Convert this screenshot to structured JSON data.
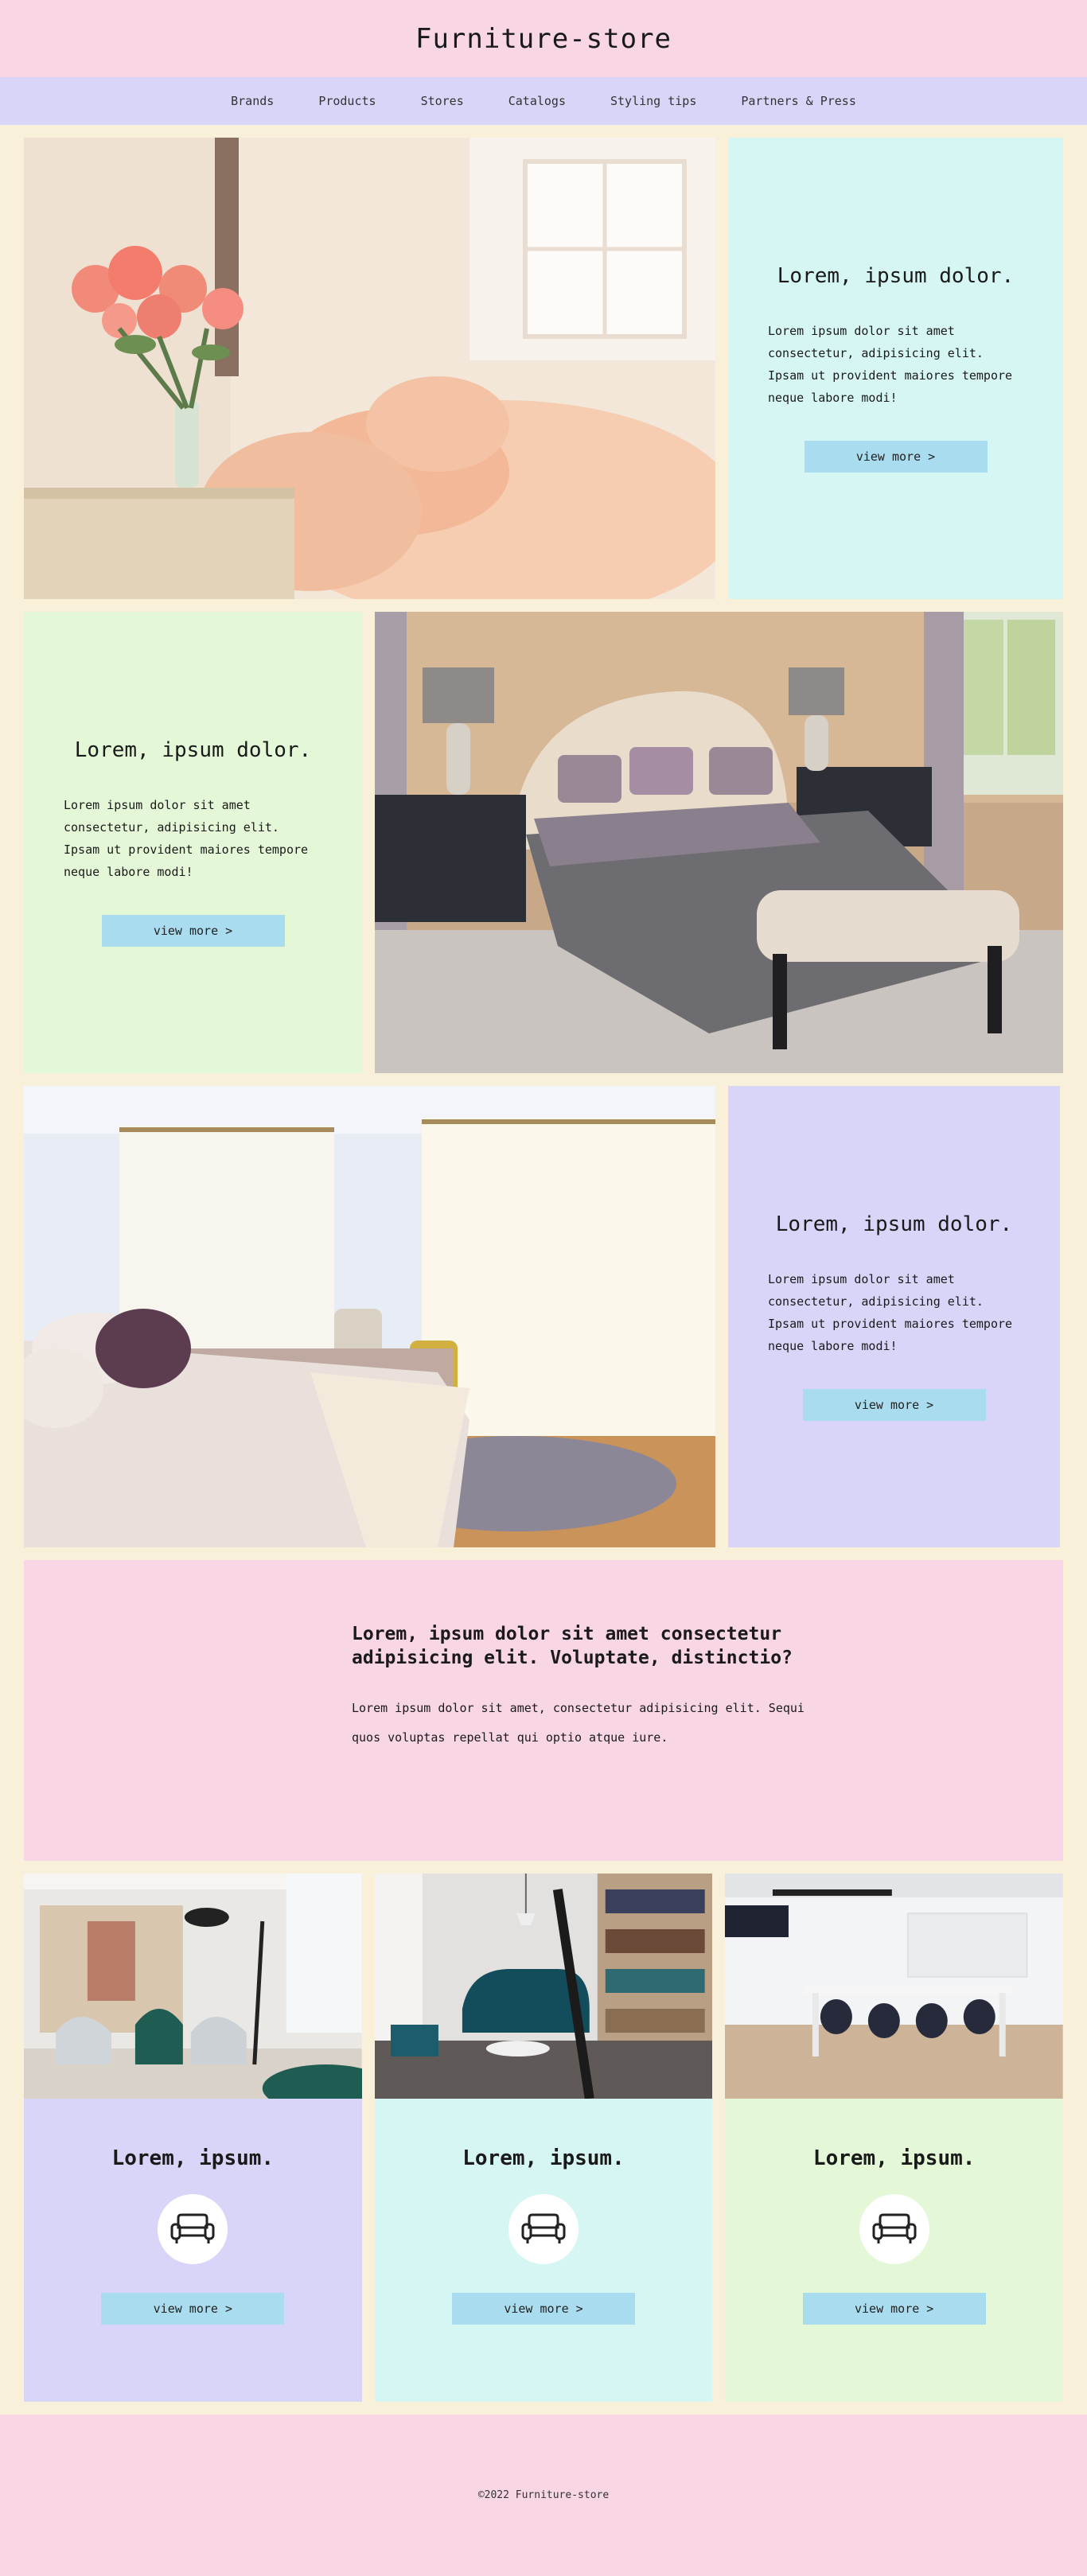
{
  "site": {
    "title": "Furniture-store"
  },
  "nav": {
    "items": [
      "Brands",
      "Products",
      "Stores",
      "Catalogs",
      "Styling tips",
      "Partners & Press"
    ]
  },
  "sections": [
    {
      "heading": "Lorem, ipsum dolor.",
      "text": "Lorem ipsum dolor sit amet consectetur, adipisicing elit. Ipsam ut provident maiores tempore neque labore modi!",
      "button": "view more >",
      "bg": "#d6f6f4"
    },
    {
      "heading": "Lorem, ipsum dolor.",
      "text": "Lorem ipsum dolor sit amet consectetur, adipisicing elit. Ipsam ut provident maiores tempore neque labore modi!",
      "button": "view more >",
      "bg": "#e4f8d8"
    },
    {
      "heading": "Lorem, ipsum dolor.",
      "text": "Lorem ipsum dolor sit amet consectetur, adipisicing elit. Ipsam ut provident maiores tempore neque labore modi!",
      "button": "view more >",
      "bg": "#d9d5f8"
    }
  ],
  "feature": {
    "heading": "Lorem, ipsum dolor sit amet consectetur adipisicing elit. Voluptate, distinctio?",
    "text": "Lorem ipsum dolor sit amet, consectetur adipisicing elit. Sequi quos voluptas repellat qui optio atque iure."
  },
  "cards": [
    {
      "title": "Lorem, ipsum.",
      "icon": "sofa-icon",
      "button": "view more >",
      "bg": "#d9d5f8"
    },
    {
      "title": "Lorem, ipsum.",
      "icon": "sofa-icon",
      "button": "view more >",
      "bg": "#d6f6f4"
    },
    {
      "title": "Lorem, ipsum.",
      "icon": "sofa-icon",
      "button": "view more >",
      "bg": "#e4f8d8"
    }
  ],
  "footer": {
    "text": "©2022 Furniture-store"
  }
}
